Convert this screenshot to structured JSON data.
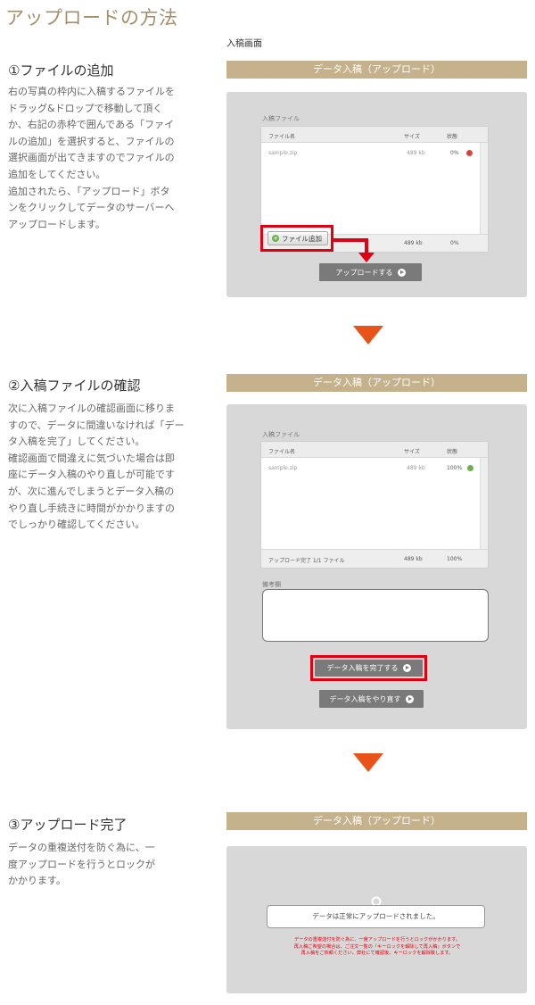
{
  "page": {
    "title": "アップロードの方法"
  },
  "steps": [
    {
      "title": "①ファイルの追加",
      "body": "右の写真の枠内に入稿するファイルを\nドラッグ&ドロップで移動して頂く\nか、右記の赤枠で囲んである「ファイ\nルの追加」を選択すると、ファイルの\n選択画面が出てきますのでファイルの\n追加をしてください。\n追加されたら、「アップロード」ボタ\nンをクリックしてデータのサーバーへ\nアップロードします。"
    },
    {
      "title": "②入稿ファイルの確認",
      "body": "次に入稿ファイルの確認画面に移りま\nすので、データに間違いなければ「デー\nタ入稿を完了」してください。\n確認画面で間違えに気づいた場合は即\n座にデータ入稿のやり直しが可能です\nが、次に進んでしまうとデータ入稿の\nやり直し手続きに時間がかかりますの\nでしっかり確認してください。"
    },
    {
      "title": "③アップロード完了",
      "body": "データの重複送付を防ぐ為に、一\n度アップロードを行うとロックが\nかかります。"
    }
  ],
  "screen1": {
    "caption": "入稿画面",
    "bar_title": "データ入稿（アップロード）",
    "field_label": "入稿ファイル",
    "columns": [
      "ファイル名",
      "サイズ",
      "状態"
    ],
    "row": {
      "name": "sample.zip",
      "size": "489 kb",
      "status": "0%"
    },
    "add_button": "ファイル追加",
    "footer_size": "489 kb",
    "footer_status": "0%",
    "upload_button": "アップロードする"
  },
  "screen2": {
    "bar_title": "データ入稿（アップロード）",
    "field_label": "入稿ファイル",
    "columns": [
      "ファイル名",
      "サイズ",
      "状態"
    ],
    "row": {
      "name": "sample.zip",
      "size": "489 kb",
      "status": "100%"
    },
    "footer_label": "アップロード完了 1/1 ファイル",
    "footer_size": "489 kb",
    "footer_status": "100%",
    "notes_label": "備考欄",
    "complete_button": "データ入稿を完了する",
    "redo_button": "データ入稿をやり直す"
  },
  "screen3": {
    "bar_title": "データ入稿（アップロード）",
    "message": "データは正常にアップロードされました。",
    "warning": "データの重複送付を防ぐ為に、一度アップロードを行うとロックがかかります。\n再入稿ご希望の場合は、ご注文一覧の『キーロックを解除して再入稿』ボタンで\n再入稿をご依頼ください。弊社にて確認後、キーロックを解除致します。"
  },
  "colors": {
    "accent": "#a38f6b",
    "bar": "#c5b28c",
    "red": "#e00012",
    "arrow": "#e8531a"
  },
  "icons": [
    "plus-icon",
    "play-icon",
    "key-icon",
    "status-error-icon",
    "status-ok-icon",
    "arrow-down-icon"
  ]
}
